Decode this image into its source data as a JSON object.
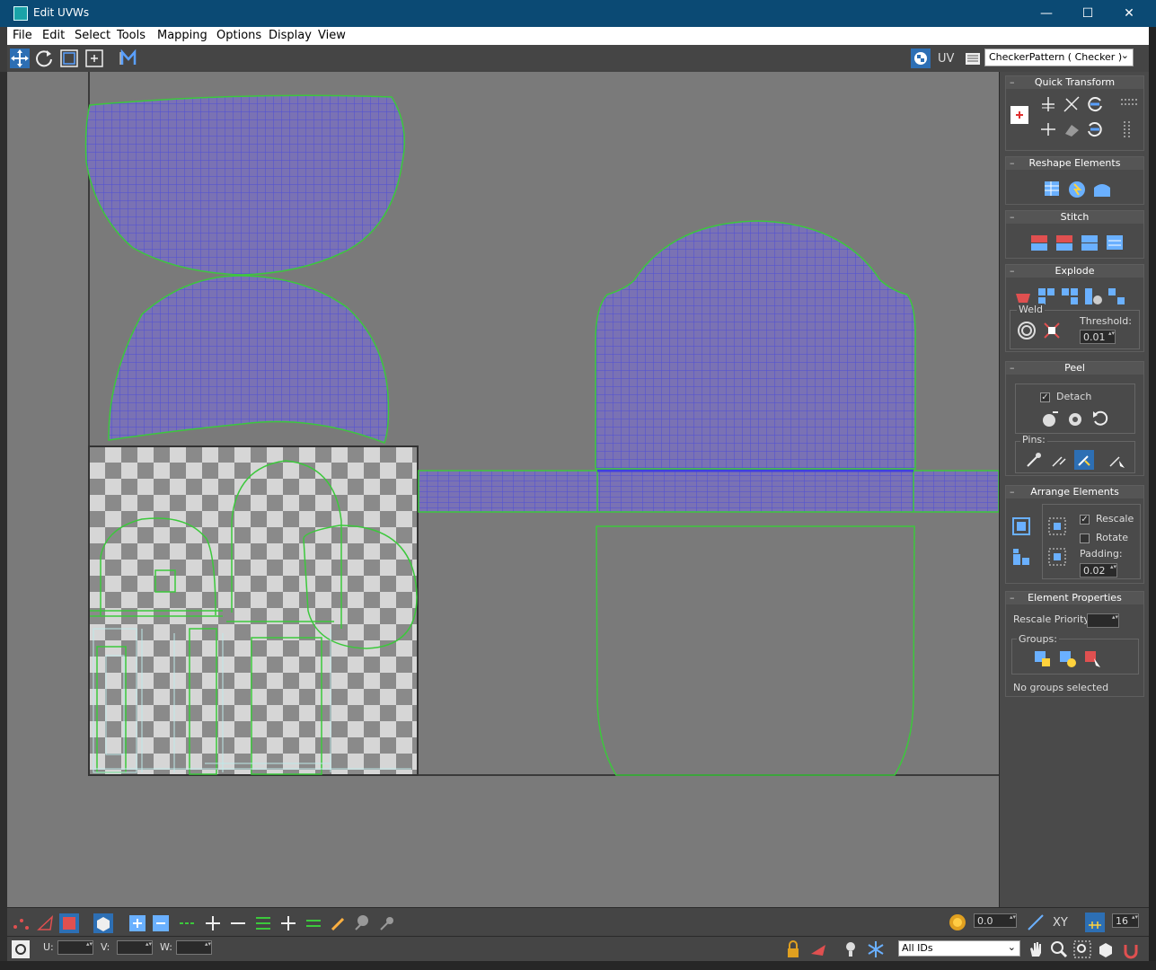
{
  "window": {
    "title": "Edit UVWs",
    "min": "—",
    "max": "☐",
    "close": "✕"
  },
  "menu": [
    "File",
    "Edit",
    "Select",
    "Tools",
    "Mapping",
    "Options",
    "Display",
    "View"
  ],
  "toolbar": {
    "uv_label": "UV",
    "texture_dropdown": "CheckerPattern  ( Checker )",
    "dropdown_arrow": "⌄"
  },
  "panel": {
    "quick_transform": {
      "title": "Quick Transform"
    },
    "reshape": {
      "title": "Reshape Elements"
    },
    "stitch": {
      "title": "Stitch"
    },
    "explode": {
      "title": "Explode",
      "weld_label": "Weld",
      "threshold_label": "Threshold:",
      "threshold_value": "0.01"
    },
    "peel": {
      "title": "Peel",
      "detach_label": "Detach",
      "detach_checked": true,
      "pins_label": "Pins:"
    },
    "arrange": {
      "title": "Arrange Elements",
      "rescale_label": "Rescale",
      "rescale_checked": true,
      "rotate_label": "Rotate",
      "rotate_checked": false,
      "padding_label": "Padding:",
      "padding_value": "0.02"
    },
    "element_props": {
      "title": "Element Properties",
      "rescale_priority_label": "Rescale Priority:",
      "rescale_priority_value": "",
      "groups_label": "Groups:",
      "status": "No groups selected"
    }
  },
  "bottom": {
    "spinner_value": "0.0",
    "axis_label": "XY",
    "grid_value": "16",
    "u_label": "U:",
    "v_label": "V:",
    "w_label": "W:",
    "ids_dropdown": "All IDs"
  },
  "colors": {
    "mesh": "#5858d8",
    "edge": "#3cc83c",
    "background": "#7a7a7a",
    "titlebar": "#0b4a74"
  }
}
